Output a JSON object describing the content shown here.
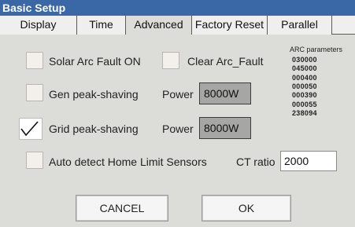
{
  "window": {
    "title": "Basic Setup"
  },
  "tabs": [
    {
      "label": "Display"
    },
    {
      "label": "Time"
    },
    {
      "label": "Advanced"
    },
    {
      "label": "Factory Reset"
    },
    {
      "label": "Parallel"
    }
  ],
  "active_tab": "Advanced",
  "options": {
    "solar_arc_fault": {
      "label": "Solar Arc Fault ON",
      "checked": false
    },
    "clear_arc_fault": {
      "label": "Clear Arc_Fault",
      "checked": false
    },
    "gen_peak_shaving": {
      "label": "Gen peak-shaving",
      "checked": false,
      "power_label": "Power",
      "power_value": "8000W"
    },
    "grid_peak_shaving": {
      "label": "Grid peak-shaving",
      "checked": true,
      "power_label": "Power",
      "power_value": "8000W"
    },
    "auto_detect": {
      "label": "Auto detect Home Limit Sensors",
      "checked": false
    }
  },
  "ct_ratio": {
    "label": "CT ratio",
    "value": "2000"
  },
  "arc_parameters": {
    "title": "ARC parameters",
    "values": [
      "030000",
      "045000",
      "000400",
      "000050",
      "000390",
      "000055",
      "238094"
    ]
  },
  "buttons": {
    "cancel": "CANCEL",
    "ok": "OK"
  },
  "colors": {
    "title_bar": "#3a68a6",
    "panel": "#dcdcd8",
    "power_box": "#a6a6a4"
  }
}
